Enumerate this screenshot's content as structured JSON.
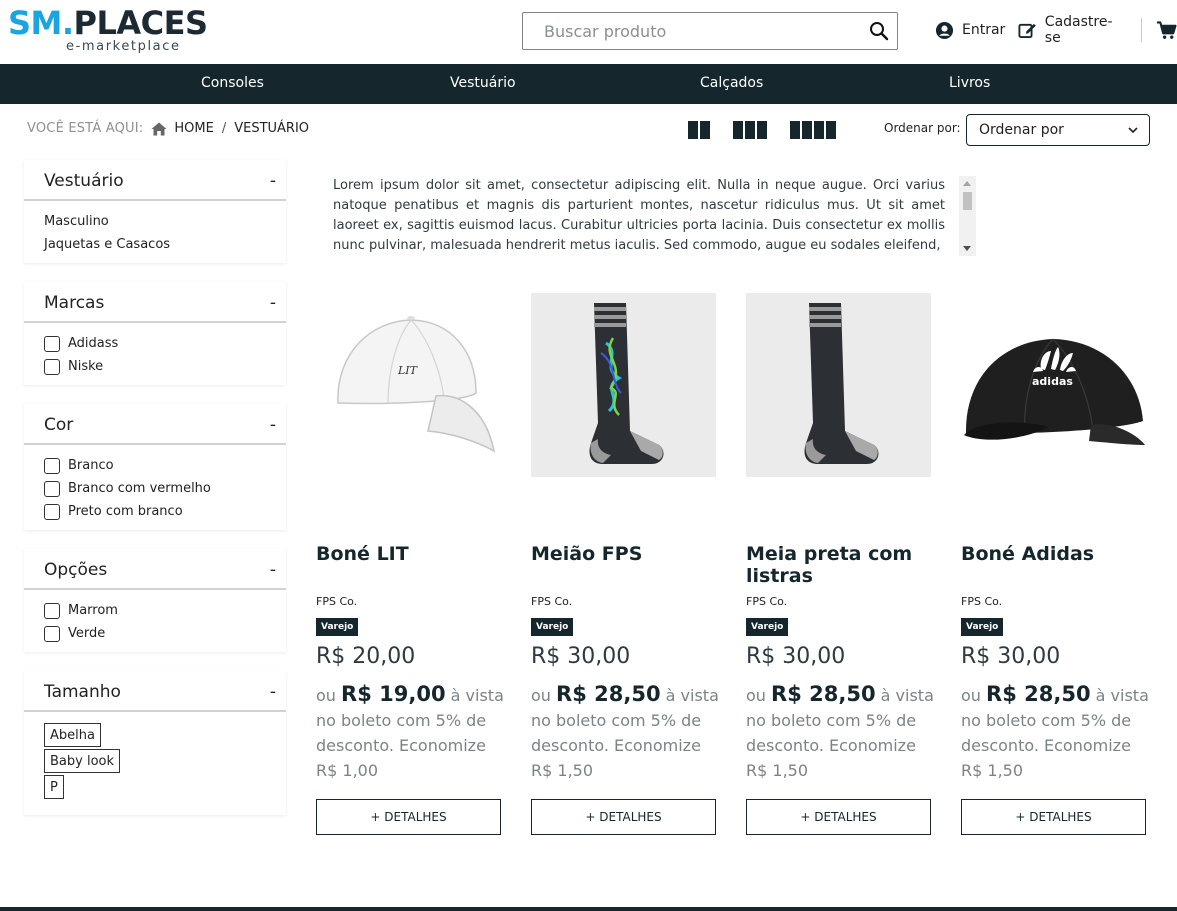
{
  "header": {
    "logo_sm": "SM",
    "logo_dot": ".",
    "logo_places": "PLACES",
    "logo_sub": "e-marketplace",
    "search_placeholder": "Buscar produto",
    "login_label": "Entrar",
    "signup_label": "Cadastre-se"
  },
  "nav": {
    "items": [
      "Consoles",
      "Vestuário",
      "Calçados",
      "Livros"
    ]
  },
  "breadcrumb": {
    "prefix": "VOCÊ ESTÁ AQUI:",
    "home": "HOME",
    "separator": "/",
    "current": "VESTUÁRIO"
  },
  "toolbar": {
    "sort_label": "Ordenar por:",
    "sort_value": "Ordenar por"
  },
  "filters": {
    "category": {
      "title": "Vestuário",
      "toggle": "-",
      "items": [
        "Masculino",
        "Jaquetas e Casacos"
      ]
    },
    "brands": {
      "title": "Marcas",
      "toggle": "-",
      "items": [
        "Adidass",
        "Niske"
      ]
    },
    "color": {
      "title": "Cor",
      "toggle": "-",
      "items": [
        "Branco",
        "Branco com vermelho",
        "Preto com branco"
      ]
    },
    "options": {
      "title": "Opções",
      "toggle": "-",
      "items": [
        "Marrom",
        "Verde"
      ]
    },
    "size": {
      "title": "Tamanho",
      "toggle": "-",
      "items": [
        "Abelha",
        "Baby look",
        "P"
      ]
    }
  },
  "description": "Lorem ipsum dolor sit amet, consectetur adipiscing elit. Nulla in neque augue. Orci varius natoque penatibus et magnis dis parturient montes, nascetur ridiculus mus. Ut sit amet laoreet ex, sagittis euismod lacus. Curabitur ultricies porta lacinia. Duis consectetur ex mollis nunc pulvinar, malesuada hendrerit metus iaculis. Sed commodo, augue eu sodales eleifend,",
  "products": [
    {
      "name": "Boné LIT",
      "seller": "FPS Co.",
      "badge": "Varejo",
      "price": "R$ 20,00",
      "promo_prefix": "ou",
      "promo_price": "R$ 19,00",
      "promo_suffix": "à vista no boleto com 5% de desconto. Economize R$ 1,00",
      "button": "+ DETALHES"
    },
    {
      "name": "Meião FPS",
      "seller": "FPS Co.",
      "badge": "Varejo",
      "price": "R$ 30,00",
      "promo_prefix": "ou",
      "promo_price": "R$ 28,50",
      "promo_suffix": "à vista no boleto com 5% de desconto. Economize R$ 1,50",
      "button": "+ DETALHES"
    },
    {
      "name": "Meia preta com listras",
      "seller": "FPS Co.",
      "badge": "Varejo",
      "price": "R$ 30,00",
      "promo_prefix": "ou",
      "promo_price": "R$ 28,50",
      "promo_suffix": "à vista no boleto com 5% de desconto. Economize R$ 1,50",
      "button": "+ DETALHES"
    },
    {
      "name": "Boné Adidas",
      "seller": "FPS Co.",
      "badge": "Varejo",
      "price": "R$ 30,00",
      "promo_prefix": "ou",
      "promo_price": "R$ 28,50",
      "promo_suffix": "à vista no boleto com 5% de desconto. Economize R$ 1,50",
      "button": "+ DETALHES"
    }
  ],
  "product_images": [
    "white-cap-lit",
    "black-sock-graffiti",
    "black-sock-stripes",
    "black-cap-adidas"
  ],
  "colors": {
    "brand_dark": "#15272d",
    "brand_blue": "#1aa5e0"
  }
}
